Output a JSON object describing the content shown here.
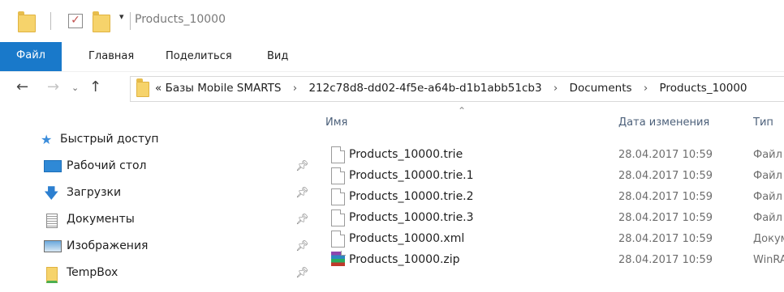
{
  "window": {
    "title": "Products_10000"
  },
  "ribbon": {
    "tabs": [
      "Файл",
      "Главная",
      "Поделиться",
      "Вид"
    ]
  },
  "address": {
    "overflow": "«",
    "segments": [
      "Базы Mobile SMARTS",
      "212c78d8-dd02-4f5e-a64b-d1b1abb51cb3",
      "Documents",
      "Products_10000"
    ],
    "separator": "›"
  },
  "nav": {
    "quick_access": "Быстрый доступ",
    "items": [
      {
        "label": "Рабочий стол",
        "icon": "desktop-icon"
      },
      {
        "label": "Загрузки",
        "icon": "downloads-icon"
      },
      {
        "label": "Документы",
        "icon": "documents-icon"
      },
      {
        "label": "Изображения",
        "icon": "pictures-icon"
      },
      {
        "label": "TempBox",
        "icon": "folder-icon"
      }
    ]
  },
  "columns": {
    "name": "Имя",
    "date": "Дата изменения",
    "type": "Тип"
  },
  "files": [
    {
      "name": "Products_10000.trie",
      "date": "28.04.2017 10:59",
      "type": "Файл",
      "icon": "file-icon"
    },
    {
      "name": "Products_10000.trie.1",
      "date": "28.04.2017 10:59",
      "type": "Файл",
      "icon": "file-icon"
    },
    {
      "name": "Products_10000.trie.2",
      "date": "28.04.2017 10:59",
      "type": "Файл",
      "icon": "file-icon"
    },
    {
      "name": "Products_10000.trie.3",
      "date": "28.04.2017 10:59",
      "type": "Файл",
      "icon": "file-icon"
    },
    {
      "name": "Products_10000.xml",
      "date": "28.04.2017 10:59",
      "type": "Докум",
      "icon": "file-icon"
    },
    {
      "name": "Products_10000.zip",
      "date": "28.04.2017 10:59",
      "type": "WinRA",
      "icon": "winrar-archive-icon"
    }
  ],
  "colors": {
    "accent": "#1979ca",
    "folder": "#f6d36b"
  }
}
